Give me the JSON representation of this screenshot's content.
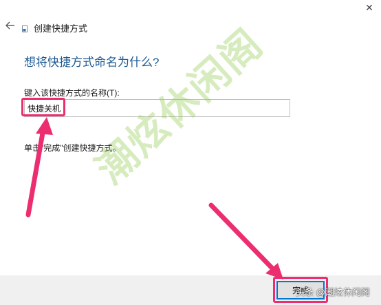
{
  "window": {
    "close_glyph": "✕",
    "wizard_title": "创建快捷方式"
  },
  "heading": "想将快捷方式命名为什么?",
  "field": {
    "label": "键入该快捷方式的名称(T):",
    "value": "快捷关机"
  },
  "instruction": "单击\"完成\"创建快捷方式。",
  "footer": {
    "finish_label": "完成",
    "credit": "头条 @潮炫休闲阁"
  },
  "watermark": "潮炫休闲阁",
  "colors": {
    "accent_heading": "#1d5a93",
    "annotation_pink": "#ec2d70",
    "button_border": "#0078d7",
    "footer_bg": "#f0f0f0"
  },
  "icons": [
    "back-arrow-icon",
    "shortcut-icon",
    "close-icon"
  ]
}
